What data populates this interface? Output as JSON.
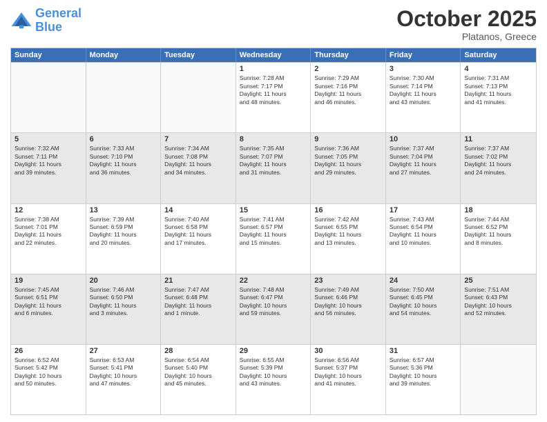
{
  "logo": {
    "line1": "General",
    "line2": "Blue"
  },
  "title": "October 2025",
  "subtitle": "Platanos, Greece",
  "header_days": [
    "Sunday",
    "Monday",
    "Tuesday",
    "Wednesday",
    "Thursday",
    "Friday",
    "Saturday"
  ],
  "rows": [
    [
      {
        "day": "",
        "empty": true
      },
      {
        "day": "",
        "empty": true
      },
      {
        "day": "",
        "empty": true
      },
      {
        "day": "1",
        "lines": [
          "Sunrise: 7:28 AM",
          "Sunset: 7:17 PM",
          "Daylight: 11 hours",
          "and 48 minutes."
        ]
      },
      {
        "day": "2",
        "lines": [
          "Sunrise: 7:29 AM",
          "Sunset: 7:16 PM",
          "Daylight: 11 hours",
          "and 46 minutes."
        ]
      },
      {
        "day": "3",
        "lines": [
          "Sunrise: 7:30 AM",
          "Sunset: 7:14 PM",
          "Daylight: 11 hours",
          "and 43 minutes."
        ]
      },
      {
        "day": "4",
        "lines": [
          "Sunrise: 7:31 AM",
          "Sunset: 7:13 PM",
          "Daylight: 11 hours",
          "and 41 minutes."
        ]
      }
    ],
    [
      {
        "day": "5",
        "shaded": true,
        "lines": [
          "Sunrise: 7:32 AM",
          "Sunset: 7:11 PM",
          "Daylight: 11 hours",
          "and 39 minutes."
        ]
      },
      {
        "day": "6",
        "shaded": true,
        "lines": [
          "Sunrise: 7:33 AM",
          "Sunset: 7:10 PM",
          "Daylight: 11 hours",
          "and 36 minutes."
        ]
      },
      {
        "day": "7",
        "shaded": true,
        "lines": [
          "Sunrise: 7:34 AM",
          "Sunset: 7:08 PM",
          "Daylight: 11 hours",
          "and 34 minutes."
        ]
      },
      {
        "day": "8",
        "shaded": true,
        "lines": [
          "Sunrise: 7:35 AM",
          "Sunset: 7:07 PM",
          "Daylight: 11 hours",
          "and 31 minutes."
        ]
      },
      {
        "day": "9",
        "shaded": true,
        "lines": [
          "Sunrise: 7:36 AM",
          "Sunset: 7:05 PM",
          "Daylight: 11 hours",
          "and 29 minutes."
        ]
      },
      {
        "day": "10",
        "shaded": true,
        "lines": [
          "Sunrise: 7:37 AM",
          "Sunset: 7:04 PM",
          "Daylight: 11 hours",
          "and 27 minutes."
        ]
      },
      {
        "day": "11",
        "shaded": true,
        "lines": [
          "Sunrise: 7:37 AM",
          "Sunset: 7:02 PM",
          "Daylight: 11 hours",
          "and 24 minutes."
        ]
      }
    ],
    [
      {
        "day": "12",
        "lines": [
          "Sunrise: 7:38 AM",
          "Sunset: 7:01 PM",
          "Daylight: 11 hours",
          "and 22 minutes."
        ]
      },
      {
        "day": "13",
        "lines": [
          "Sunrise: 7:39 AM",
          "Sunset: 6:59 PM",
          "Daylight: 11 hours",
          "and 20 minutes."
        ]
      },
      {
        "day": "14",
        "lines": [
          "Sunrise: 7:40 AM",
          "Sunset: 6:58 PM",
          "Daylight: 11 hours",
          "and 17 minutes."
        ]
      },
      {
        "day": "15",
        "lines": [
          "Sunrise: 7:41 AM",
          "Sunset: 6:57 PM",
          "Daylight: 11 hours",
          "and 15 minutes."
        ]
      },
      {
        "day": "16",
        "lines": [
          "Sunrise: 7:42 AM",
          "Sunset: 6:55 PM",
          "Daylight: 11 hours",
          "and 13 minutes."
        ]
      },
      {
        "day": "17",
        "lines": [
          "Sunrise: 7:43 AM",
          "Sunset: 6:54 PM",
          "Daylight: 11 hours",
          "and 10 minutes."
        ]
      },
      {
        "day": "18",
        "lines": [
          "Sunrise: 7:44 AM",
          "Sunset: 6:52 PM",
          "Daylight: 11 hours",
          "and 8 minutes."
        ]
      }
    ],
    [
      {
        "day": "19",
        "shaded": true,
        "lines": [
          "Sunrise: 7:45 AM",
          "Sunset: 6:51 PM",
          "Daylight: 11 hours",
          "and 6 minutes."
        ]
      },
      {
        "day": "20",
        "shaded": true,
        "lines": [
          "Sunrise: 7:46 AM",
          "Sunset: 6:50 PM",
          "Daylight: 11 hours",
          "and 3 minutes."
        ]
      },
      {
        "day": "21",
        "shaded": true,
        "lines": [
          "Sunrise: 7:47 AM",
          "Sunset: 6:48 PM",
          "Daylight: 11 hours",
          "and 1 minute."
        ]
      },
      {
        "day": "22",
        "shaded": true,
        "lines": [
          "Sunrise: 7:48 AM",
          "Sunset: 6:47 PM",
          "Daylight: 10 hours",
          "and 59 minutes."
        ]
      },
      {
        "day": "23",
        "shaded": true,
        "lines": [
          "Sunrise: 7:49 AM",
          "Sunset: 6:46 PM",
          "Daylight: 10 hours",
          "and 56 minutes."
        ]
      },
      {
        "day": "24",
        "shaded": true,
        "lines": [
          "Sunrise: 7:50 AM",
          "Sunset: 6:45 PM",
          "Daylight: 10 hours",
          "and 54 minutes."
        ]
      },
      {
        "day": "25",
        "shaded": true,
        "lines": [
          "Sunrise: 7:51 AM",
          "Sunset: 6:43 PM",
          "Daylight: 10 hours",
          "and 52 minutes."
        ]
      }
    ],
    [
      {
        "day": "26",
        "lines": [
          "Sunrise: 6:52 AM",
          "Sunset: 5:42 PM",
          "Daylight: 10 hours",
          "and 50 minutes."
        ]
      },
      {
        "day": "27",
        "lines": [
          "Sunrise: 6:53 AM",
          "Sunset: 5:41 PM",
          "Daylight: 10 hours",
          "and 47 minutes."
        ]
      },
      {
        "day": "28",
        "lines": [
          "Sunrise: 6:54 AM",
          "Sunset: 5:40 PM",
          "Daylight: 10 hours",
          "and 45 minutes."
        ]
      },
      {
        "day": "29",
        "lines": [
          "Sunrise: 6:55 AM",
          "Sunset: 5:39 PM",
          "Daylight: 10 hours",
          "and 43 minutes."
        ]
      },
      {
        "day": "30",
        "lines": [
          "Sunrise: 6:56 AM",
          "Sunset: 5:37 PM",
          "Daylight: 10 hours",
          "and 41 minutes."
        ]
      },
      {
        "day": "31",
        "lines": [
          "Sunrise: 6:57 AM",
          "Sunset: 5:36 PM",
          "Daylight: 10 hours",
          "and 39 minutes."
        ]
      },
      {
        "day": "",
        "empty": true
      }
    ]
  ]
}
